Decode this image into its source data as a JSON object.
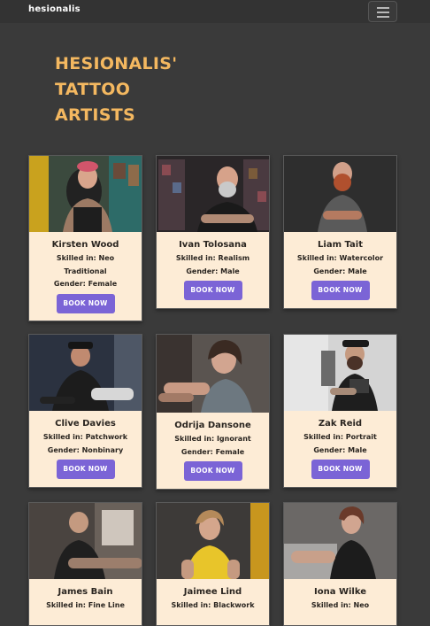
{
  "nav": {
    "brand": "hesionalis"
  },
  "header": {
    "title_lines": [
      "HESIONALIS'",
      "TATTOO",
      "ARTISTS"
    ]
  },
  "colors": {
    "accent": "#f4b860",
    "button": "#7b64d6",
    "card": "#fdecd6",
    "background": "#3a3a3a"
  },
  "artists": [
    {
      "name": "Kirsten Wood",
      "skill_lines": [
        "Skilled in: Neo",
        "Traditional"
      ],
      "gender_label": "Gender: Female",
      "button_label": "BOOK NOW"
    },
    {
      "name": "Ivan Tolosana",
      "skill_lines": [
        "Skilled in: Realism"
      ],
      "gender_label": "Gender: Male",
      "button_label": "BOOK NOW"
    },
    {
      "name": "Liam Tait",
      "skill_lines": [
        "Skilled in: Watercolor"
      ],
      "gender_label": "Gender: Male",
      "button_label": "BOOK NOW"
    },
    {
      "name": "Clive Davies",
      "skill_lines": [
        "Skilled in: Patchwork"
      ],
      "gender_label": "Gender: Nonbinary",
      "button_label": "BOOK NOW"
    },
    {
      "name": "Odrija Dansone",
      "skill_lines": [
        "Skilled in: Ignorant"
      ],
      "gender_label": "Gender: Female",
      "button_label": "BOOK NOW"
    },
    {
      "name": "Zak Reid",
      "skill_lines": [
        "Skilled in: Portrait"
      ],
      "gender_label": "Gender: Male",
      "button_label": "BOOK NOW"
    },
    {
      "name": "James Bain",
      "skill_lines": [
        "Skilled in: Fine Line"
      ],
      "gender_label": "",
      "button_label": ""
    },
    {
      "name": "Jaimee Lind",
      "skill_lines": [
        "Skilled in: Blackwork"
      ],
      "gender_label": "",
      "button_label": ""
    },
    {
      "name": "Iona Wilke",
      "skill_lines": [
        "Skilled in: Neo"
      ],
      "gender_label": "",
      "button_label": ""
    }
  ]
}
